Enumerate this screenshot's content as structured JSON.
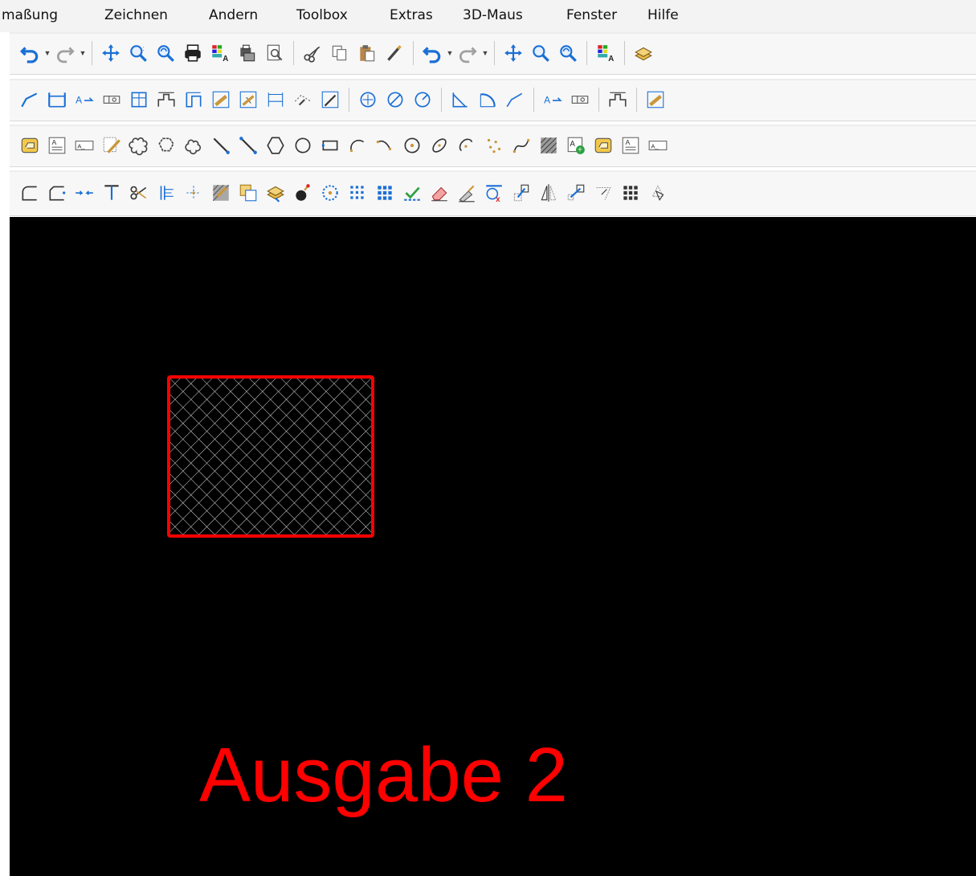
{
  "menu": {
    "items": [
      {
        "label": "maßung"
      },
      {
        "label": "Zeichnen"
      },
      {
        "label": "Andern"
      },
      {
        "label": "Toolbox"
      },
      {
        "label": "Extras"
      },
      {
        "label": "3D-Maus"
      },
      {
        "label": "Fenster"
      },
      {
        "label": "Hilfe"
      }
    ]
  },
  "canvas": {
    "background": "#000000",
    "shape": {
      "type": "hatched-rectangle",
      "outline_color": "#ff0000",
      "hatch_color": "#ffffff"
    },
    "text": {
      "value": "Ausgabe 2",
      "color": "#ff0000"
    }
  }
}
